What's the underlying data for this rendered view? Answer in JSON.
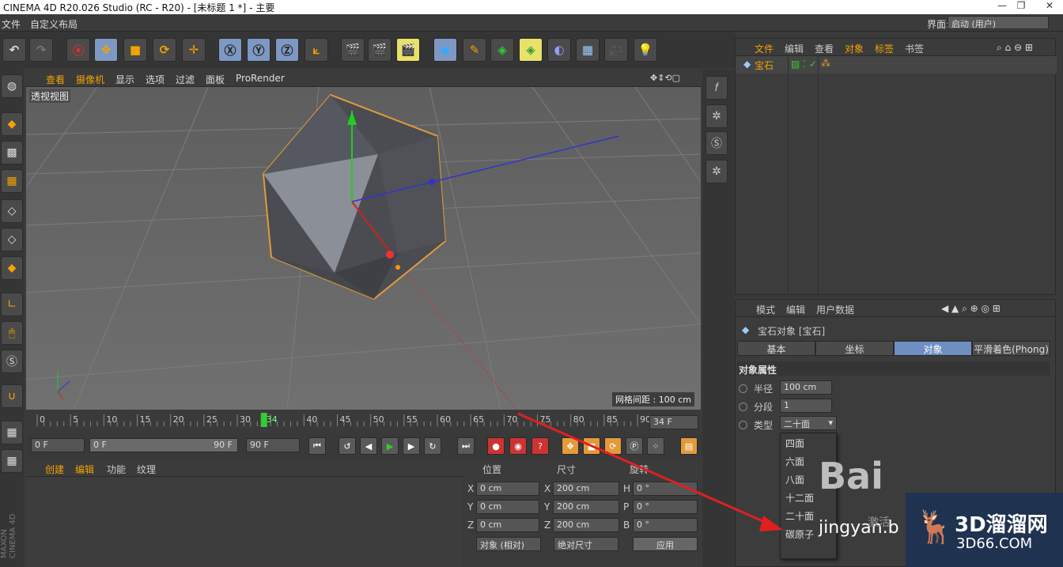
{
  "titlebar": {
    "title": "CINEMA 4D R20.026 Studio (RC - R20) - [未标题 1 *] - 主要"
  },
  "menubar": {
    "items": [
      "文件",
      "自定义布局"
    ],
    "layout_label": "界面:",
    "layout_value": "启动 (用户)"
  },
  "viewport": {
    "menu": [
      "查看",
      "摄像机",
      "显示",
      "选项",
      "过滤",
      "面板",
      "ProRender"
    ],
    "label": "透视视图",
    "grid": "网格间距 : 100 cm"
  },
  "timeline": {
    "ticks": [
      "0",
      "5",
      "10",
      "15",
      "20",
      "25",
      "30",
      "34",
      "40",
      "45",
      "50",
      "55",
      "60",
      "65",
      "70",
      "75",
      "80",
      "85",
      "90"
    ],
    "current": "34 F"
  },
  "playbar": {
    "start": "0 F",
    "range_start": "0 F",
    "range_end": "90 F",
    "end": "90 F"
  },
  "materials": {
    "menu": [
      "创建",
      "编辑",
      "功能",
      "纹理"
    ]
  },
  "coords": {
    "headers": [
      "位置",
      "尺寸",
      "旋转"
    ],
    "pos": [
      [
        "X",
        "0 cm"
      ],
      [
        "Y",
        "0 cm"
      ],
      [
        "Z",
        "0 cm"
      ]
    ],
    "size": [
      [
        "X",
        "200 cm"
      ],
      [
        "Y",
        "200 cm"
      ],
      [
        "Z",
        "200 cm"
      ]
    ],
    "rot": [
      [
        "H",
        "0 °"
      ],
      [
        "P",
        "0 °"
      ],
      [
        "B",
        "0 °"
      ]
    ],
    "mode1": "对象 (相对)",
    "mode2": "绝对尺寸",
    "apply": "应用"
  },
  "objmgr": {
    "menu": [
      "文件",
      "编辑",
      "查看",
      "对象",
      "标签",
      "书签"
    ],
    "object": "宝石"
  },
  "attrmgr": {
    "menu": [
      "模式",
      "编辑",
      "用户数据"
    ],
    "title": "宝石对象 [宝石]",
    "tabs": [
      "基本",
      "坐标",
      "对象",
      "平滑着色(Phong)"
    ],
    "section": "对象属性",
    "radius_label": "半径",
    "radius": "100 cm",
    "seg_label": "分段",
    "seg": "1",
    "type_label": "类型",
    "type": "二十面",
    "options": [
      "四面",
      "六面",
      "八面",
      "十二面",
      "二十面",
      "碳原子"
    ]
  },
  "watermark": {
    "baidu": "Bai",
    "jingyan": "jingyan.b",
    "brand": "3D溜溜网",
    "url": "3D66.COM",
    "side": "激活"
  }
}
